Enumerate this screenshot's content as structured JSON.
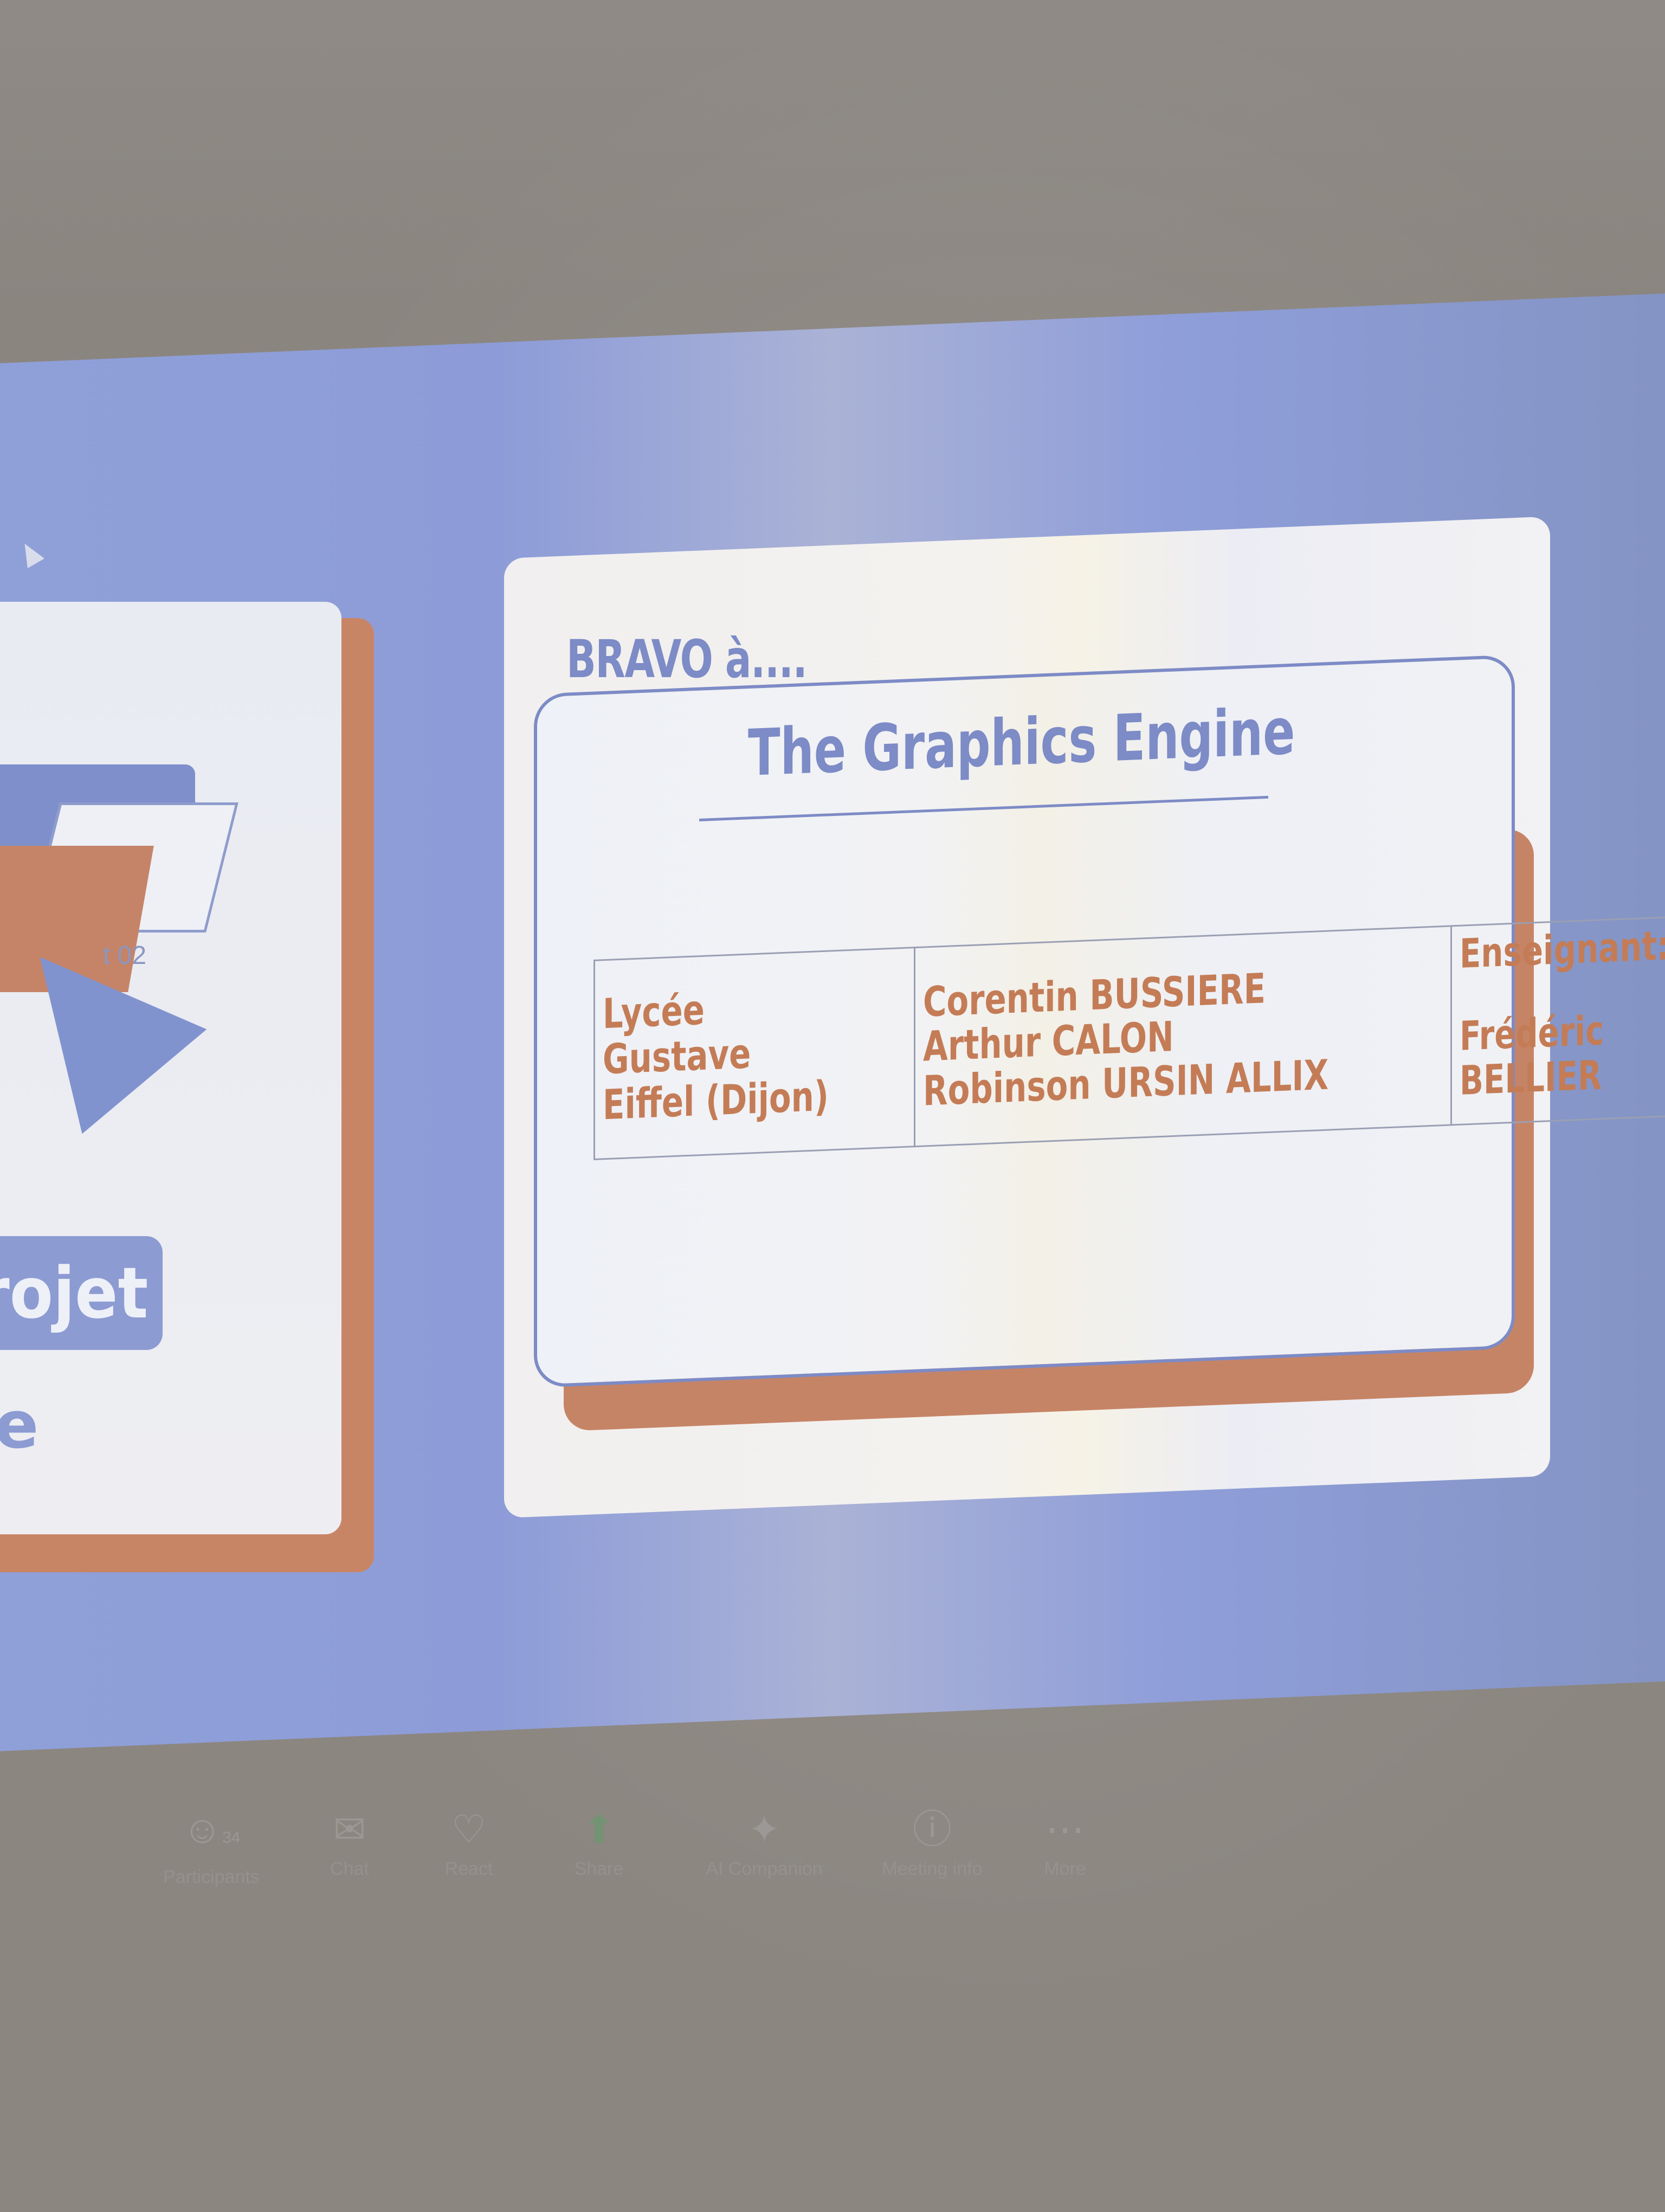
{
  "left_slide": {
    "label": "t 02",
    "button_label": "rojet",
    "bottom_letter": "e"
  },
  "main_slide": {
    "heading": "BRAVO à....",
    "title": "The Graphics Engine",
    "school": "Lycée Gustave Eiffel (Dijon)",
    "students": [
      "Corentin BUSSIERE",
      "Arthur CALON",
      "Robinson URSIN ALLIX"
    ],
    "teacher_label": "Enseignant:",
    "teacher_name_1": "Frédéric",
    "teacher_name_2": "BELLIER"
  },
  "toolbar": {
    "participants_count": "34",
    "items": {
      "participants": {
        "label": "Participants",
        "icon": "participants-icon"
      },
      "chat": {
        "label": "Chat",
        "icon": "chat-icon"
      },
      "react": {
        "label": "React",
        "icon": "heart-icon"
      },
      "share": {
        "label": "Share",
        "icon": "share-icon"
      },
      "ai": {
        "label": "AI Companion",
        "icon": "sparkle-icon"
      },
      "info": {
        "label": "Meeting info",
        "icon": "info-icon"
      },
      "more": {
        "label": "More",
        "icon": "more-icon"
      }
    }
  },
  "colors": {
    "accent_blue": "#7d8bc6",
    "accent_orange": "#c47c56"
  }
}
